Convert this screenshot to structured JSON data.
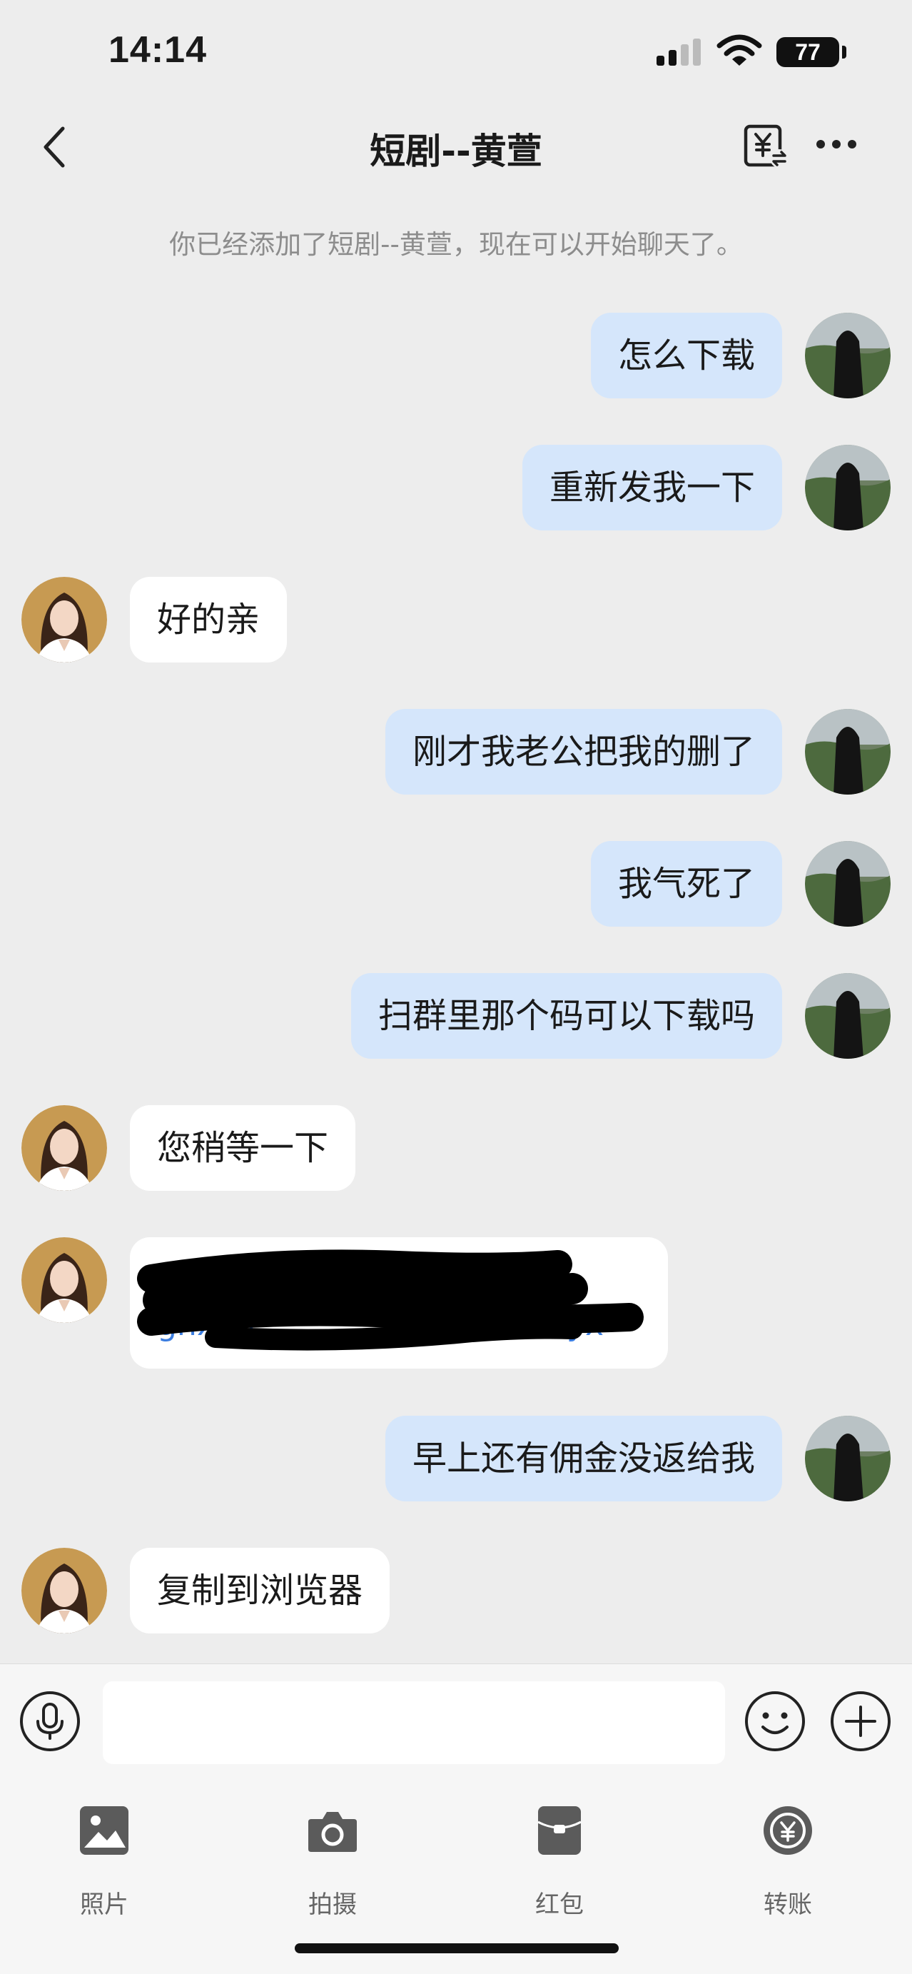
{
  "status_bar": {
    "time": "14:14",
    "battery": "77"
  },
  "header": {
    "title": "短剧--黄萱"
  },
  "system_notice": "你已经添加了短剧--黄萱，现在可以开始聊天了。",
  "messages": [
    {
      "side": "right",
      "text": "怎么下载"
    },
    {
      "side": "right",
      "text": "重新发我一下"
    },
    {
      "side": "left",
      "text": "好的亲"
    },
    {
      "side": "right",
      "text": "刚才我老公把我的删了"
    },
    {
      "side": "right",
      "text": "我气死了"
    },
    {
      "side": "right",
      "text": "扫群里那个码可以下载吗"
    },
    {
      "side": "left",
      "text": "您稍等一下"
    },
    {
      "side": "left",
      "type": "link",
      "lines": [
        "h",
        "gnx9h",
        "yx"
      ]
    },
    {
      "side": "right",
      "text": "早上还有佣金没返给我"
    },
    {
      "side": "left",
      "text": "复制到浏览器"
    }
  ],
  "input": {
    "placeholder": ""
  },
  "toolbar": {
    "items": [
      {
        "label": "照片",
        "icon": "photo-icon"
      },
      {
        "label": "拍摄",
        "icon": "camera-icon"
      },
      {
        "label": "红包",
        "icon": "red-packet-icon"
      },
      {
        "label": "转账",
        "icon": "transfer-yuan-icon"
      }
    ]
  },
  "colors": {
    "background": "#ededed",
    "sent_bubble": "#d5e6fb",
    "received_bubble": "#ffffff",
    "link": "#3b7de0"
  }
}
